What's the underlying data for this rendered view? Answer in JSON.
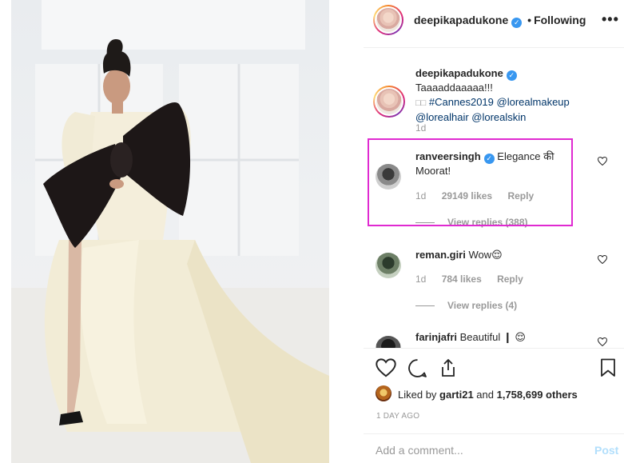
{
  "post": {
    "author": "deepikapadukone",
    "follow_separator": "•",
    "follow_status": "Following",
    "more_label": "•••",
    "verified_glyph": "✓"
  },
  "caption": {
    "username": "deepikapadukone",
    "text_1": "Taaaaddaaaaa!!! ",
    "glyphs": "□□",
    "hashtag": "#Cannes2019",
    "mentions": "@lorealmakeup @lorealhair @lorealskin",
    "time": "1d"
  },
  "comments": [
    {
      "username": "ranveersingh",
      "text": "Elegance की Moorat!",
      "time": "1d",
      "likes": "29149 likes",
      "reply": "Reply",
      "view_replies": "View replies (388)"
    },
    {
      "username": "reman.giri",
      "text": "Wow😌",
      "time": "1d",
      "likes": "784 likes",
      "reply": "Reply",
      "view_replies": "View replies (4)"
    },
    {
      "username": "farinjafri",
      "text": "Beautiful ❙ 😌"
    }
  ],
  "actions": {
    "liked_by_prefix": "Liked by ",
    "liked_by_user": "garti21",
    "liked_by_mid": " and ",
    "liked_by_count": "1,758,699 others",
    "timestamp": "1 DAY AGO"
  },
  "composer": {
    "placeholder": "Add a comment...",
    "post_label": "Post"
  },
  "icons": [
    "heart-icon",
    "comment-icon",
    "share-icon",
    "bookmark-icon",
    "more-icon",
    "verified-icon"
  ],
  "colors": {
    "highlight": "#e02ad1",
    "link": "#003569",
    "verified": "#3897f0",
    "post_disabled": "#b2dffc"
  }
}
